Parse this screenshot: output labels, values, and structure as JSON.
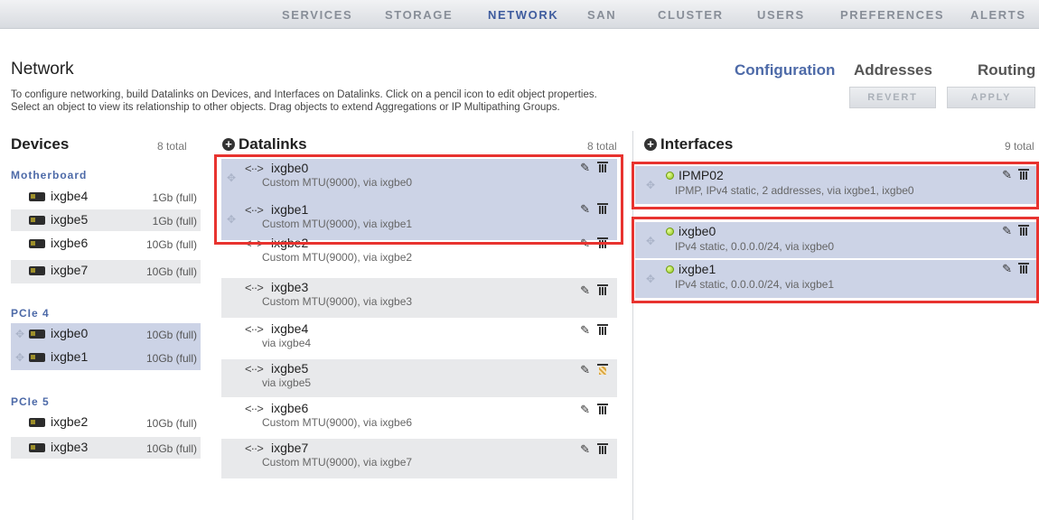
{
  "nav": {
    "items": [
      "SERVICES",
      "STORAGE",
      "NETWORK",
      "SAN",
      "CLUSTER",
      "USERS",
      "PREFERENCES",
      "ALERTS"
    ],
    "active": "NETWORK"
  },
  "page": {
    "title": "Network",
    "subnav": [
      "Configuration",
      "Addresses",
      "Routing"
    ],
    "active_subnav": "Configuration",
    "help_line1": "To configure networking, build Datalinks on Devices, and Interfaces on Datalinks. Click on a pencil icon to edit object properties.",
    "help_line2": "Select an object to view its relationship to other objects. Drag objects to extend Aggregations or IP Multipathing Groups.",
    "revert_label": "REVERT",
    "apply_label": "APPLY"
  },
  "devices": {
    "title": "Devices",
    "count": "8 total",
    "groups": [
      {
        "label": "Motherboard",
        "items": [
          {
            "name": "ixgbe4",
            "speed": "1Gb (full)"
          },
          {
            "name": "ixgbe5",
            "speed": "1Gb (full)"
          },
          {
            "name": "ixgbe6",
            "speed": "10Gb (full)"
          },
          {
            "name": "ixgbe7",
            "speed": "10Gb (full)"
          }
        ]
      },
      {
        "label": "PCIe 4",
        "items": [
          {
            "name": "ixgbe0",
            "speed": "10Gb (full)"
          },
          {
            "name": "ixgbe1",
            "speed": "10Gb (full)"
          }
        ]
      },
      {
        "label": "PCIe 5",
        "items": [
          {
            "name": "ixgbe2",
            "speed": "10Gb (full)"
          },
          {
            "name": "ixgbe3",
            "speed": "10Gb (full)"
          }
        ]
      }
    ]
  },
  "datalinks": {
    "title": "Datalinks",
    "count": "8 total",
    "items": [
      {
        "arrow": "<··>",
        "name": "ixgbe0",
        "desc": "Custom MTU(9000), via ixgbe0"
      },
      {
        "arrow": "<··>",
        "name": "ixgbe1",
        "desc": "Custom MTU(9000), via ixgbe1"
      },
      {
        "arrow": "<··>",
        "name": "ixgbe2",
        "desc": "Custom MTU(9000), via ixgbe2"
      },
      {
        "arrow": "<··>",
        "name": "ixgbe3",
        "desc": "Custom MTU(9000), via ixgbe3"
      },
      {
        "arrow": "<··>",
        "name": "ixgbe4",
        "desc": "via ixgbe4"
      },
      {
        "arrow": "<··>",
        "name": "ixgbe5",
        "desc": "via ixgbe5"
      },
      {
        "arrow": "<··>",
        "name": "ixgbe6",
        "desc": "Custom MTU(9000), via ixgbe6"
      },
      {
        "arrow": "<··>",
        "name": "ixgbe7",
        "desc": "Custom MTU(9000), via ixgbe7"
      }
    ]
  },
  "interfaces": {
    "title": "Interfaces",
    "count": "9 total",
    "items": [
      {
        "name": "IPMP02",
        "desc": "IPMP, IPv4 static, 2 addresses, via ixgbe1, ixgbe0"
      },
      {
        "name": "ixgbe0",
        "desc": "IPv4 static, 0.0.0.0/24, via ixgbe0"
      },
      {
        "name": "ixgbe1",
        "desc": "IPv4 static, 0.0.0.0/24, via ixgbe1"
      }
    ]
  },
  "colors": {
    "accent": "#4d6aa8",
    "row_alt": "#e8e9eb",
    "row_selected": "#ccd3e6",
    "highlight_box": "#e8332f",
    "status_green": "#8cc21c"
  }
}
